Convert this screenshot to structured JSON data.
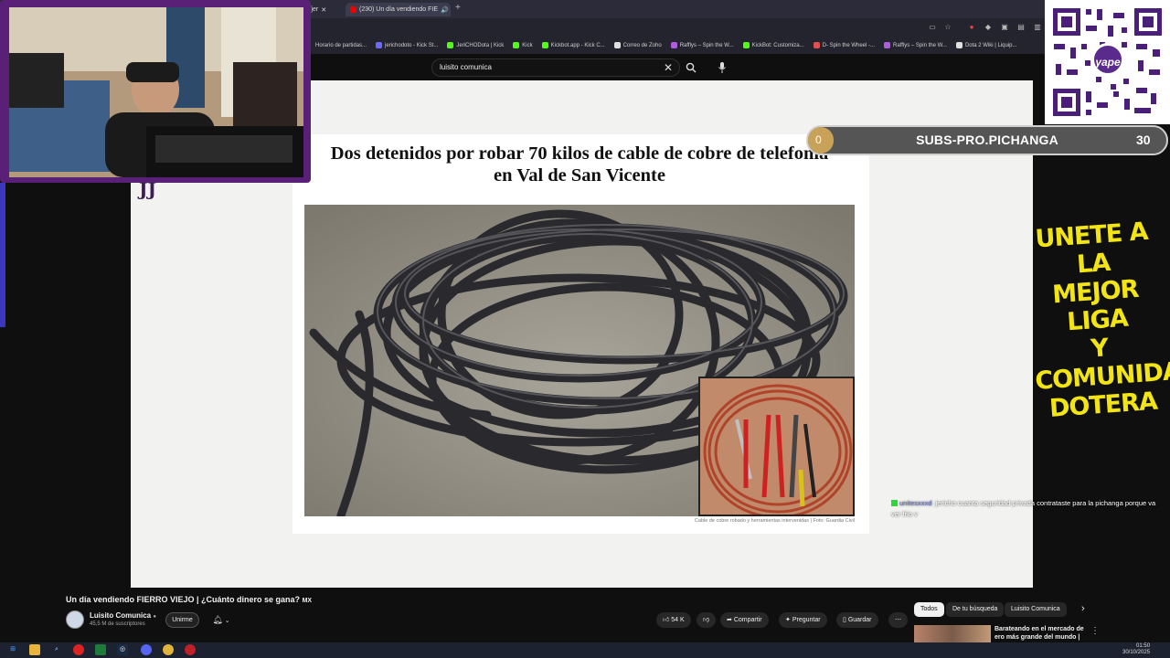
{
  "browser": {
    "tabs": [
      {
        "label": "s/jer"
      },
      {
        "label": "(230) Un día vendiendo FIE"
      }
    ],
    "new_tab_label": "+",
    "bookmarks": [
      {
        "label": "Horario de partidas...",
        "color": "#9a9a9a"
      },
      {
        "label": "jerichodoto - Kick St...",
        "color": "#6a6aff"
      },
      {
        "label": "JeriCHODota | Kick",
        "color": "#53fc18"
      },
      {
        "label": "Kick",
        "color": "#53fc18"
      },
      {
        "label": "Kickbot.app - Kick C...",
        "color": "#53fc18"
      },
      {
        "label": "Correo de Zoho",
        "color": "#e0e0e0"
      },
      {
        "label": "Rafflys – Spin the W...",
        "color": "#b05ce0"
      },
      {
        "label": "KickBot: Customiza...",
        "color": "#53fc18"
      },
      {
        "label": "D- Spin the Wheel -...",
        "color": "#e05050"
      },
      {
        "label": "Rafflys – Spin the W...",
        "color": "#b05ce0"
      },
      {
        "label": "Dota 2 Wiki | Liquip...",
        "color": "#e0e0e0"
      }
    ]
  },
  "search": {
    "query": "luisito comunica",
    "clear_icon": "close-icon",
    "search_icon": "search-icon",
    "mic_icon": "mic-icon"
  },
  "article": {
    "headline_line1": "Dos detenidos por robar 70 kilos de cable de cobre de telefonía",
    "headline_line2": "en Val de San Vicente",
    "caption": "Cable de cobre robado y herramientas intervenidas | Foto: Guardia Civil"
  },
  "overlay": {
    "qr_badge": "yape",
    "subs_current": "0",
    "subs_label": "SUBS-PRO.PICHANGA",
    "subs_goal": "30",
    "subs_progress": 0,
    "promo_lines": [
      "UNETE A LA",
      "MEJOR LIGA",
      "Y COMUNIDAD",
      "DOTERA"
    ],
    "promo_color": "#f3e512"
  },
  "chat": {
    "username": "unitesxxxd",
    "message": "jericho cuanta seguridad privada contrataste para la pichanga porque va ver frio v"
  },
  "video": {
    "title": "Un día vendiendo FIERRO VIEJO | ¿Cuánto dinero se gana?",
    "title_flag": "MX",
    "channel": "Luisito Comunica",
    "verified_icon": "verified-icon",
    "subscribers": "45,5 M de suscriptores",
    "join_label": "Unirme",
    "likes": "54 K",
    "share_label": "Compartir",
    "ask_label": "Preguntar",
    "save_label": "Guardar",
    "chips": [
      "Todos",
      "De tu búsqueda",
      "Luisito Comunica"
    ],
    "recommended_title": "Barateando en el mercado de ero más grande del mundo | ..."
  },
  "taskbar": {
    "time": "01:50",
    "date": "30/10/2025"
  }
}
